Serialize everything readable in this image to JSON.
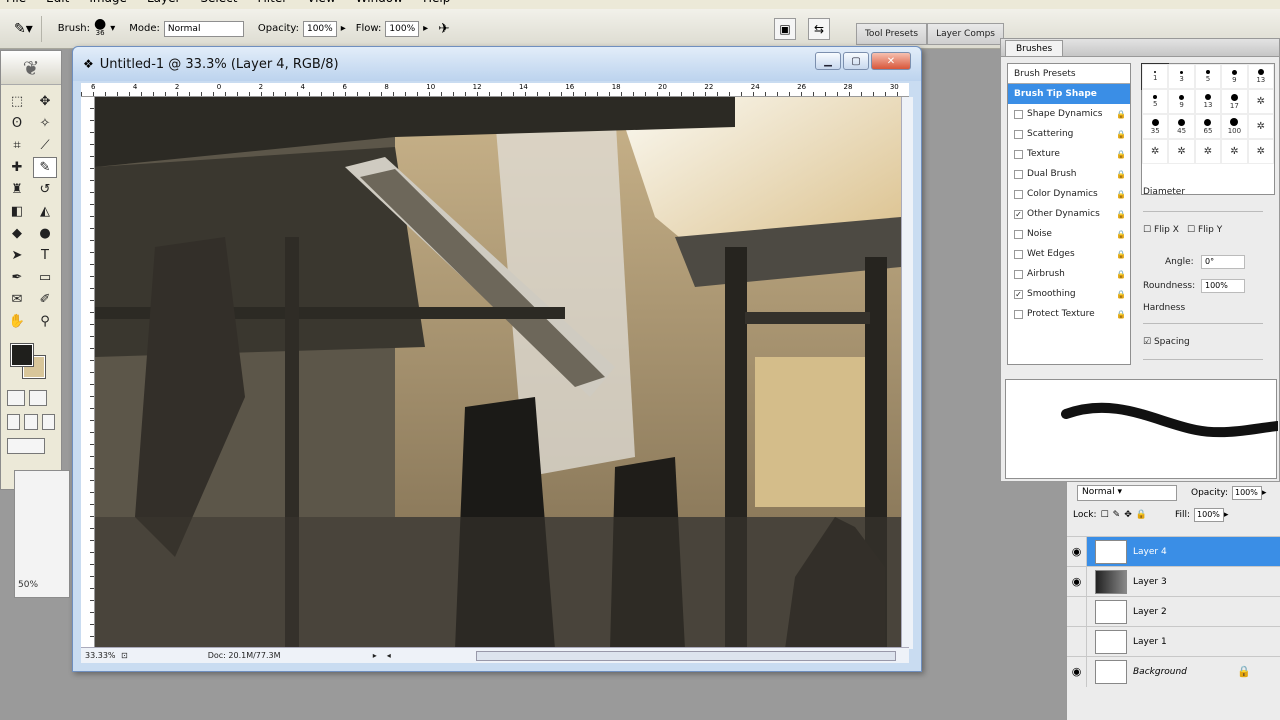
{
  "menu": [
    "File",
    "Edit",
    "Image",
    "Layer",
    "Select",
    "Filter",
    "View",
    "Window",
    "Help"
  ],
  "options": {
    "brush_label": "Brush:",
    "brush_size": "36",
    "mode_label": "Mode:",
    "mode_value": "Normal",
    "opacity_label": "Opacity:",
    "opacity_value": "100%",
    "flow_label": "Flow:",
    "flow_value": "100%",
    "tab_tool_presets": "Tool Presets",
    "tab_layer_comps": "Layer Comps"
  },
  "document": {
    "title": "Untitled-1 @ 33.3% (Layer 4, RGB/8)",
    "zoom": "33.33%",
    "doc_size": "Doc: 20.1M/77.3M",
    "ruler_top": [
      "6",
      "4",
      "2",
      "0",
      "2",
      "4",
      "6",
      "8",
      "10",
      "12",
      "14",
      "16",
      "18",
      "20",
      "22",
      "24",
      "26",
      "28",
      "30"
    ],
    "colors": {
      "sky": "#f3f1e6",
      "warm": "#d9bd86",
      "dark": "#2f2d28"
    }
  },
  "navigator": {
    "zoom": "50%"
  },
  "brushes": {
    "tab": "Brushes",
    "list": [
      {
        "label": "Brush Presets",
        "checked": null,
        "type": "header"
      },
      {
        "label": "Brush Tip Shape",
        "checked": null,
        "type": "selected"
      },
      {
        "label": "Shape Dynamics",
        "checked": false
      },
      {
        "label": "Scattering",
        "checked": false
      },
      {
        "label": "Texture",
        "checked": false
      },
      {
        "label": "Dual Brush",
        "checked": false
      },
      {
        "label": "Color Dynamics",
        "checked": false
      },
      {
        "label": "Other Dynamics",
        "checked": true
      },
      {
        "label": "Noise",
        "checked": false
      },
      {
        "label": "Wet Edges",
        "checked": false
      },
      {
        "label": "Airbrush",
        "checked": false
      },
      {
        "label": "Smoothing",
        "checked": true
      },
      {
        "label": "Protect Texture",
        "checked": false
      }
    ],
    "tips": [
      {
        "size": "1",
        "d": 2
      },
      {
        "size": "3",
        "d": 3
      },
      {
        "size": "5",
        "d": 4
      },
      {
        "size": "9",
        "d": 5
      },
      {
        "size": "13",
        "d": 6
      },
      {
        "size": "5",
        "d": 4
      },
      {
        "size": "9",
        "d": 5
      },
      {
        "size": "13",
        "d": 6
      },
      {
        "size": "17",
        "d": 7
      },
      {
        "size": "",
        "d": 0
      },
      {
        "size": "35",
        "d": 7
      },
      {
        "size": "45",
        "d": 7
      },
      {
        "size": "65",
        "d": 7
      },
      {
        "size": "100",
        "d": 8
      },
      {
        "size": "",
        "d": 0
      },
      {
        "size": "",
        "d": 0
      },
      {
        "size": "",
        "d": 0
      },
      {
        "size": "",
        "d": 0
      },
      {
        "size": "",
        "d": 0
      },
      {
        "size": "",
        "d": 0
      }
    ],
    "diameter_label": "Diameter",
    "flip_x": "Flip X",
    "flip_y": "Flip Y",
    "angle_label": "Angle:",
    "angle_value": "0°",
    "roundness_label": "Roundness:",
    "roundness_value": "100%",
    "hardness_label": "Hardness",
    "spacing_label": "Spacing"
  },
  "layers": {
    "blend_mode": "Normal",
    "opacity_label": "Opacity:",
    "opacity_value": "100%",
    "lock_label": "Lock:",
    "fill_label": "Fill:",
    "fill_value": "100%",
    "items": [
      {
        "name": "Layer 4",
        "visible": true,
        "selected": true
      },
      {
        "name": "Layer 3",
        "visible": true,
        "selected": false
      },
      {
        "name": "Layer 2",
        "visible": false,
        "selected": false
      },
      {
        "name": "Layer 1",
        "visible": false,
        "selected": false
      },
      {
        "name": "Background",
        "visible": true,
        "selected": false,
        "locked": true
      }
    ]
  }
}
